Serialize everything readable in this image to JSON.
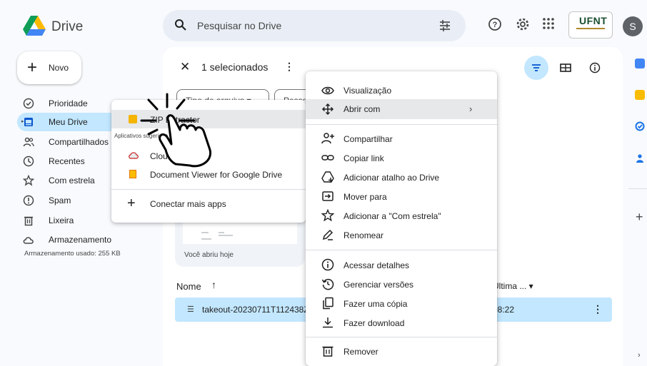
{
  "header": {
    "brand": "Drive",
    "search_placeholder": "Pesquisar no Drive",
    "org_logo_text": "UFNT",
    "avatar_letter": "S"
  },
  "sidebar": {
    "new_label": "Novo",
    "items": [
      {
        "label": "Prioridade",
        "icon": "check-circle-icon"
      },
      {
        "label": "Meu Drive",
        "icon": "my-drive-icon",
        "active": true
      },
      {
        "label": "Compartilhados",
        "icon": "shared-icon"
      },
      {
        "label": "Recentes",
        "icon": "clock-icon"
      },
      {
        "label": "Com estrela",
        "icon": "star-icon"
      },
      {
        "label": "Spam",
        "icon": "spam-icon"
      },
      {
        "label": "Lixeira",
        "icon": "trash-icon"
      },
      {
        "label": "Armazenamento",
        "icon": "cloud-icon"
      }
    ],
    "storage_used": "Armazenamento usado: 255 KB"
  },
  "main": {
    "selection_text": "1 selecionados",
    "filter_chip_type": "Tipo de arquivo",
    "filter_chip_people": "Pesso",
    "card_label": "Você abriu hoje",
    "col_name": "Nome",
    "col_last_modified": "Última ...",
    "row": {
      "name": "takeout-20230711T112438Z",
      "time": "08:22"
    }
  },
  "apps_menu": {
    "items": [
      {
        "label": "ZIP Extractor",
        "icon": "zip-extractor-icon"
      },
      {
        "label": "CloudConvert",
        "icon": "cloudconvert-icon"
      },
      {
        "label": "Document Viewer for Google Drive",
        "icon": "document-viewer-icon"
      }
    ],
    "section_label": "Aplicativos sugeridos",
    "connect_label": "Conectar mais apps"
  },
  "context_menu": {
    "items": [
      "Visualização",
      "Abrir com",
      "Compartilhar",
      "Copiar link",
      "Adicionar atalho ao Drive",
      "Mover para",
      "Adicionar a \"Com estrela\"",
      "Renomear",
      "Acessar detalhes",
      "Gerenciar versões",
      "Fazer uma cópia",
      "Fazer download",
      "Remover"
    ]
  },
  "colors": {
    "accent": "#c2e7ff",
    "background": "#f8fafd",
    "search_bg": "#e9eef6"
  }
}
